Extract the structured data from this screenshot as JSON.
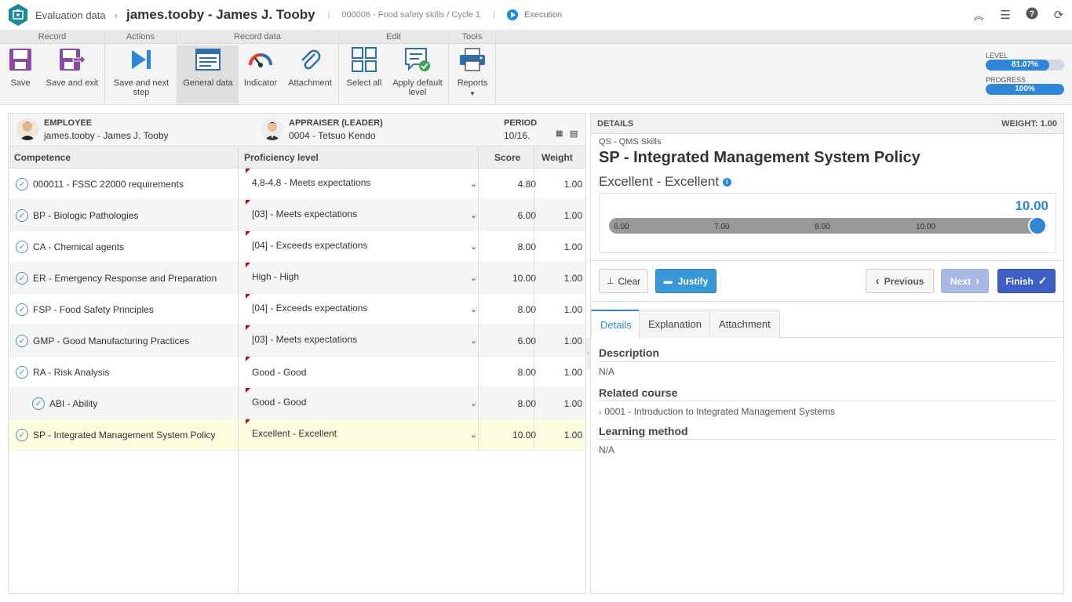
{
  "breadcrumb": {
    "root": "Evaluation data",
    "title": "james.tooby - James J. Tooby",
    "context": "000006 - Food safety skills / Cycle 1",
    "status": "Execution"
  },
  "ribbon": {
    "groups": {
      "record": "Record",
      "actions": "Actions",
      "record_data": "Record data",
      "edit": "Edit",
      "tools": "Tools"
    },
    "buttons": {
      "save": "Save",
      "save_exit": "Save and exit",
      "save_next_1": "Save and next",
      "save_next_2": "step",
      "general_data": "General data",
      "indicator": "Indicator",
      "attachment": "Attachment",
      "select_all": "Select all",
      "apply_default_1": "Apply default",
      "apply_default_2": "level",
      "reports": "Reports"
    },
    "meters": {
      "level_label": "LEVEL",
      "level_text": "81.07%",
      "level_value": 0.8107,
      "progress_label": "PROGRESS",
      "progress_text": "100%",
      "progress_value": 1.0
    }
  },
  "header": {
    "employee_label": "EMPLOYEE",
    "employee_value": "james.tooby - James J. Tooby",
    "appraiser_label": "APPRAISER (LEADER)",
    "appraiser_value": "0004 - Tetsuo Kendo",
    "period_label": "PERIOD",
    "period_value": "10/16."
  },
  "columns": {
    "competence": "Competence",
    "proficiency": "Proficiency level",
    "score": "Score",
    "weight": "Weight"
  },
  "rows": [
    {
      "competence": "000011 - FSSC 22000 requirements",
      "proficiency": "4,8-4,8 - Meets expectations",
      "score": "4.80",
      "weight": "1.00"
    },
    {
      "competence": "BP - Biologic Pathologies",
      "proficiency": "[03] - Meets expectations",
      "score": "6.00",
      "weight": "1.00"
    },
    {
      "competence": "CA - Chemical agents",
      "proficiency": "[04] - Exceeds expectations",
      "score": "8.00",
      "weight": "1.00"
    },
    {
      "competence": "ER - Emergency Response and Preparation",
      "proficiency": "High - High",
      "score": "10.00",
      "weight": "1.00"
    },
    {
      "competence": "FSP - Food Safety Principles",
      "proficiency": "[04] - Exceeds expectations",
      "score": "8.00",
      "weight": "1.00"
    },
    {
      "competence": "GMP - Good Manufacturing Practices",
      "proficiency": "[03] - Meets expectations",
      "score": "6.00",
      "weight": "1.00"
    },
    {
      "competence": "RA - Risk Analysis",
      "proficiency": "Good - Good",
      "score": "8.00",
      "weight": "1.00"
    },
    {
      "competence": "ABI - Ability",
      "proficiency": "Good - Good",
      "score": "8.00",
      "weight": "1.00"
    },
    {
      "competence": "SP - Integrated Management System Policy",
      "proficiency": "Excellent - Excellent",
      "score": "10.00",
      "weight": "1.00"
    }
  ],
  "details": {
    "header": "DETAILS",
    "weight": "WEIGHT: 1.00",
    "category": "QS - QMS Skills",
    "title": "SP - Integrated Management System Policy",
    "level": "Excellent - Excellent",
    "slider": {
      "value_text": "10.00",
      "value": 10.0,
      "ticks": [
        "6.00",
        "7.00",
        "8.00",
        "10.00"
      ]
    },
    "buttons": {
      "clear": "Clear",
      "justify": "Justify",
      "previous": "Previous",
      "next": "Next",
      "finish": "Finish"
    },
    "tabs": [
      "Details",
      "Explanation",
      "Attachment"
    ],
    "description_label": "Description",
    "description_value": "N/A",
    "related_course_label": "Related course",
    "related_course_value": "0001 - Introduction to Integrated Management Systems",
    "learning_method_label": "Learning method",
    "learning_method_value": "N/A"
  },
  "colors": {
    "accent": "#2f86d9",
    "finish_button": "#3d5fc4",
    "justify_button": "#3b98d8",
    "selected_row": "#fdfde0",
    "logo": "#1d8a99"
  }
}
